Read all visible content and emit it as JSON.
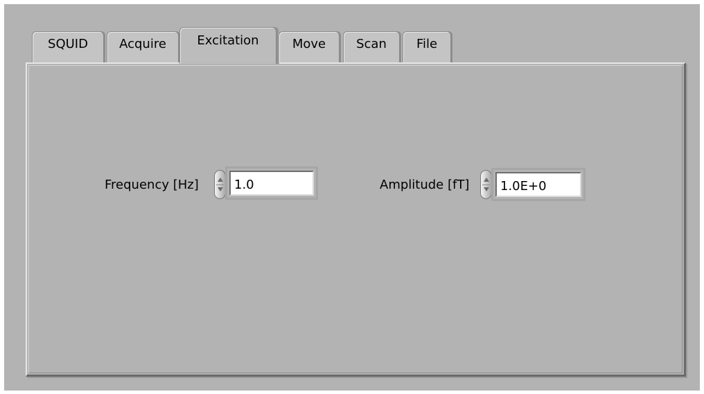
{
  "tabs": [
    {
      "label": "SQUID",
      "active": false
    },
    {
      "label": "Acquire",
      "active": false
    },
    {
      "label": "Excitation",
      "active": true
    },
    {
      "label": "Move",
      "active": false
    },
    {
      "label": "Scan",
      "active": false
    },
    {
      "label": "File",
      "active": false
    }
  ],
  "excitation": {
    "frequency": {
      "label": "Frequency [Hz]",
      "value": "1.0"
    },
    "amplitude": {
      "label": "Amplitude [fT]",
      "value": "1.0E+0"
    }
  }
}
